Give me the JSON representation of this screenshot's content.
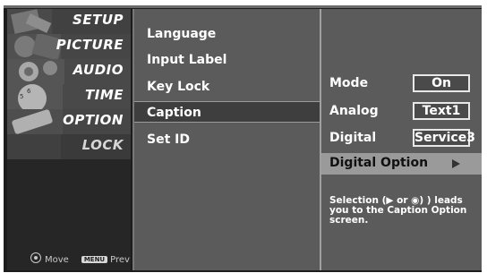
{
  "left_menu": {
    "items": [
      {
        "label": "SETUP",
        "icon": "setup-photo"
      },
      {
        "label": "PICTURE",
        "icon": "picture-photo"
      },
      {
        "label": "AUDIO",
        "icon": "audio-photo"
      },
      {
        "label": "TIME",
        "icon": "time-photo"
      },
      {
        "label": "OPTION",
        "icon": "option-photo"
      },
      {
        "label": "LOCK",
        "icon": "lock-photo"
      }
    ],
    "hint_move": "Move",
    "hint_menu_badge": "MENU",
    "hint_prev": "Prev"
  },
  "middle_menu": {
    "items": [
      "Language",
      "Input Label",
      "Key Lock",
      "Caption",
      "Set ID"
    ],
    "selected": "Caption"
  },
  "caption_options": {
    "mode": {
      "label": "Mode",
      "value": "On"
    },
    "analog": {
      "label": "Analog",
      "value": "Text1"
    },
    "digital": {
      "label": "Digital",
      "value": "Service3"
    },
    "digital_option": {
      "label": "Digital Option"
    },
    "help_text": "Selection (▶ or ◉) ) leads you to the Caption Option screen."
  },
  "colors": {
    "panel": "#5b5b5b",
    "frame": "#1c1c1c",
    "highlight": "#9a9a9a",
    "text": "#ffffff"
  }
}
